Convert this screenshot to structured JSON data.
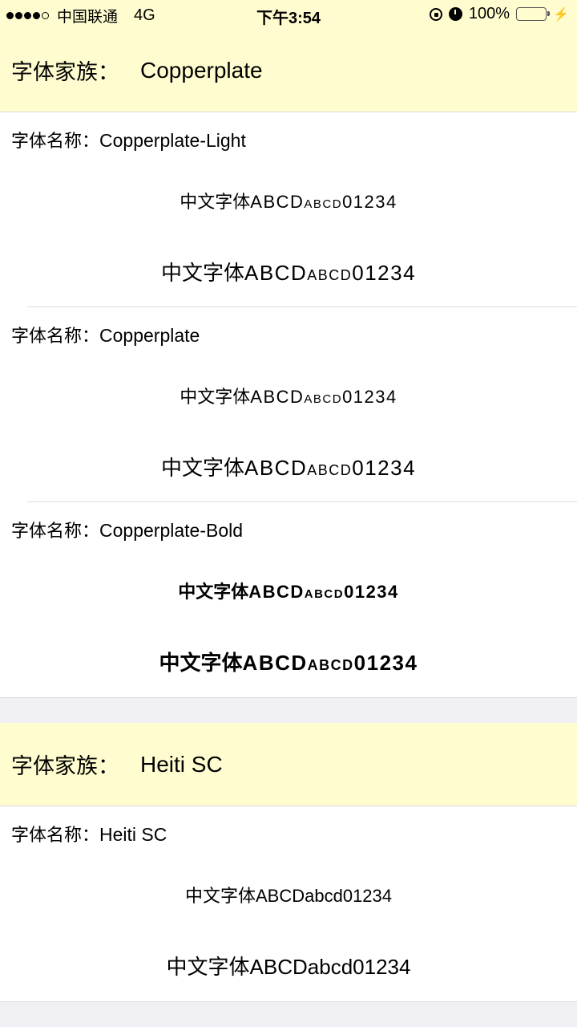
{
  "status_bar": {
    "carrier": "中国联通",
    "network": "4G",
    "time": "下午3:54",
    "battery": "100%",
    "icons": [
      "signal-dots",
      "orientation-lock-icon",
      "alarm-icon",
      "battery-icon",
      "charging-bolt-icon"
    ],
    "battery_color": "#4cd964"
  },
  "colors": {
    "header_bg": "#fffdcf",
    "page_bg": "#efeff4",
    "row_bg": "#ffffff"
  },
  "sections": [
    {
      "family_label": "字体家族：",
      "family_name": "Copperplate",
      "fonts": [
        {
          "name_label": "字体名称：",
          "name": "Copperplate-Light",
          "sample_cjk": "中文字体",
          "sample_latin": "ABCDabcd01234"
        },
        {
          "name_label": "字体名称：",
          "name": "Copperplate",
          "sample_cjk": "中文字体",
          "sample_latin": "ABCDabcd01234"
        },
        {
          "name_label": "字体名称：",
          "name": "Copperplate-Bold",
          "sample_cjk": "中文字体",
          "sample_latin": "ABCDabcd01234"
        }
      ]
    },
    {
      "family_label": "字体家族：",
      "family_name": "Heiti SC",
      "fonts": [
        {
          "name_label": "字体名称：",
          "name": "Heiti SC",
          "sample_cjk": "中文字体",
          "sample_latin": "ABCDabcd01234"
        }
      ]
    }
  ]
}
